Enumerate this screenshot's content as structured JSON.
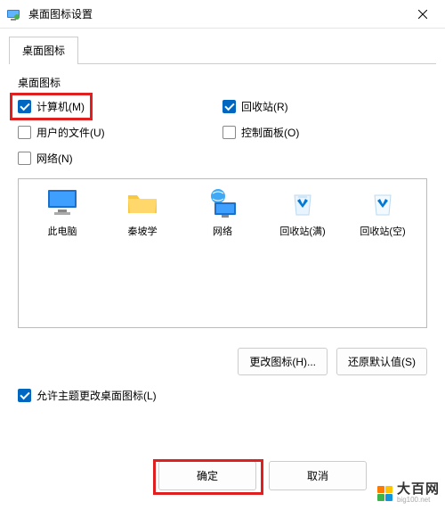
{
  "window": {
    "title": "桌面图标设置"
  },
  "tabs": {
    "main": "桌面图标"
  },
  "group": {
    "label": "桌面图标"
  },
  "checks": {
    "computer": {
      "label": "计算机(M)",
      "checked": true
    },
    "recycle": {
      "label": "回收站(R)",
      "checked": true
    },
    "userfiles": {
      "label": "用户的文件(U)",
      "checked": false
    },
    "control": {
      "label": "控制面板(O)",
      "checked": false
    },
    "network": {
      "label": "网络(N)",
      "checked": false
    }
  },
  "icons": {
    "thispc": "此电脑",
    "qinpoxue": "秦坡学",
    "network": "网络",
    "recycle_full": "回收站(满)",
    "recycle_empty": "回收站(空)"
  },
  "buttons": {
    "change_icon": "更改图标(H)...",
    "restore_default": "还原默认值(S)",
    "ok": "确定",
    "cancel": "取消"
  },
  "allow_theme": {
    "label": "允许主题更改桌面图标(L)",
    "checked": true
  },
  "watermark": {
    "main": "大百网",
    "sub": "big100.net"
  }
}
